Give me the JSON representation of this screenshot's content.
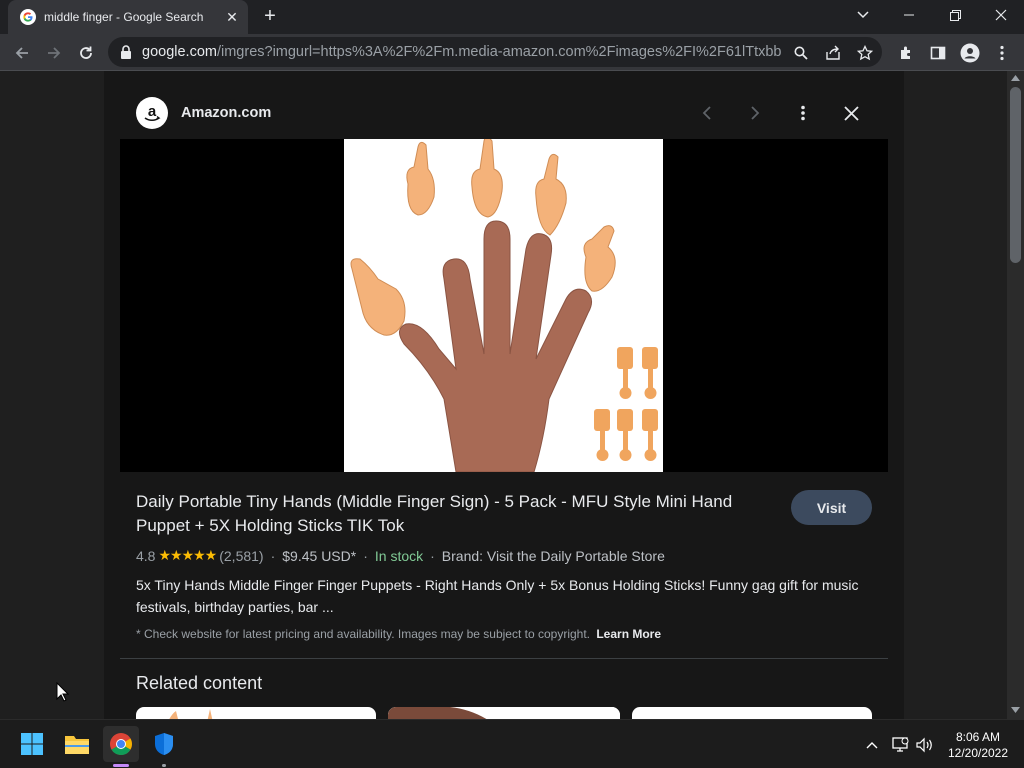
{
  "browser": {
    "tab_title": "middle finger - Google Search",
    "url_host": "google.com",
    "url_path": "/imgres?imgurl=https%3A%2F%2Fm.media-amazon.com%2Fimages%2FI%2F61lTtxbbarL.j..."
  },
  "viewer": {
    "source_name": "Amazon.com",
    "product_title": "Daily Portable Tiny Hands (Middle Finger Sign) - 5 Pack - MFU Style Mini Hand Puppet + 5X Holding Sticks TIK Tok",
    "visit_label": "Visit",
    "rating": "4.8",
    "stars": "★★★★★",
    "review_count": "(2,581)",
    "price": "$9.45 USD*",
    "availability": "In stock",
    "brand": "Brand: Visit the Daily Portable Store",
    "description": "5x Tiny Hands Middle Finger Finger Puppets - Right Hands Only + 5x Bonus Holding Sticks! Funny gag gift for music festivals, birthday parties, bar ...",
    "disclaimer": "* Check website for latest pricing and availability. Images may be subject to copyright.",
    "learn_more": "Learn More",
    "related_heading": "Related content",
    "separator": "·"
  },
  "taskbar": {
    "time": "8:06 AM",
    "date": "12/20/2022"
  },
  "colors": {
    "accent_stars": "#fbbc04",
    "in_stock": "#81c995",
    "visit_button": "#3c4a5e"
  }
}
